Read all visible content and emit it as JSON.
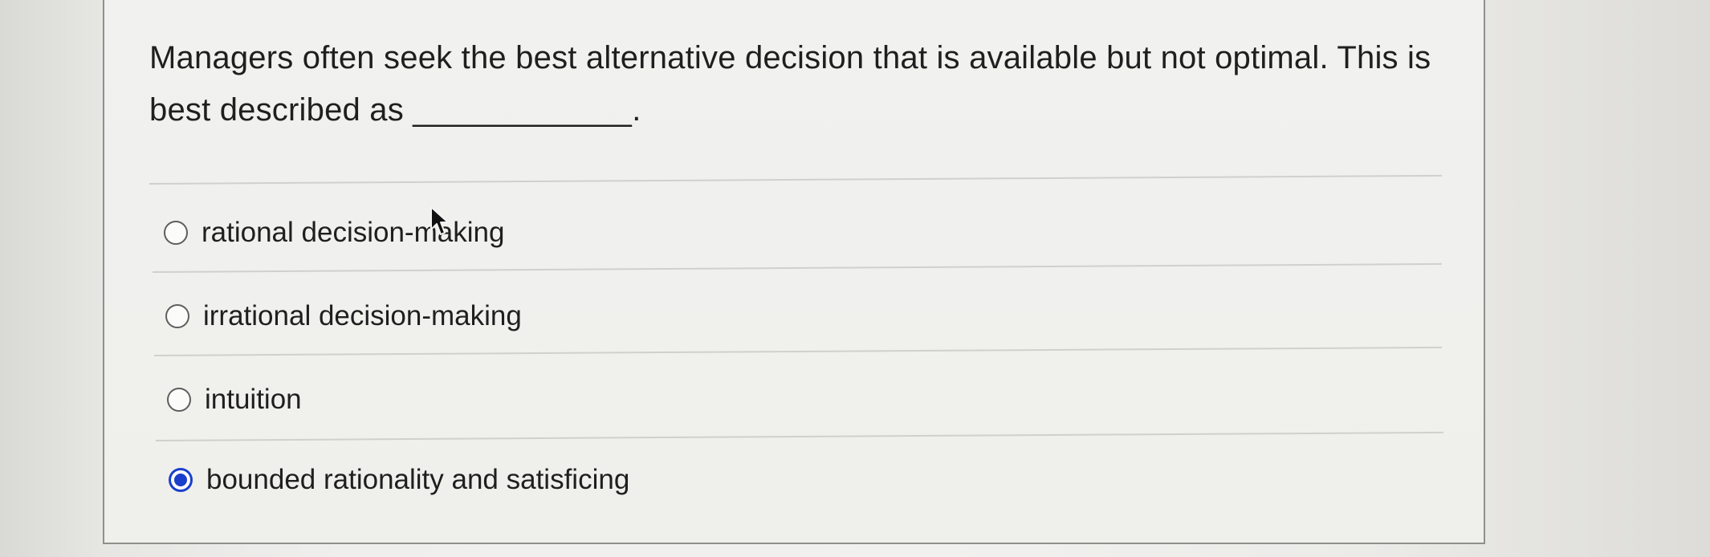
{
  "question": {
    "line1": "Managers often seek the best alternative decision that is available but not optimal. This is",
    "line2_prefix": "best described as",
    "blank": "____________."
  },
  "options": [
    {
      "label": "rational decision-making",
      "selected": false
    },
    {
      "label": "irrational decision-making",
      "selected": false
    },
    {
      "label": "intuition",
      "selected": false
    },
    {
      "label": "bounded rationality and satisficing",
      "selected": true
    }
  ],
  "colors": {
    "selected_radio": "#1a3fcc",
    "text": "#1f1f1f"
  }
}
